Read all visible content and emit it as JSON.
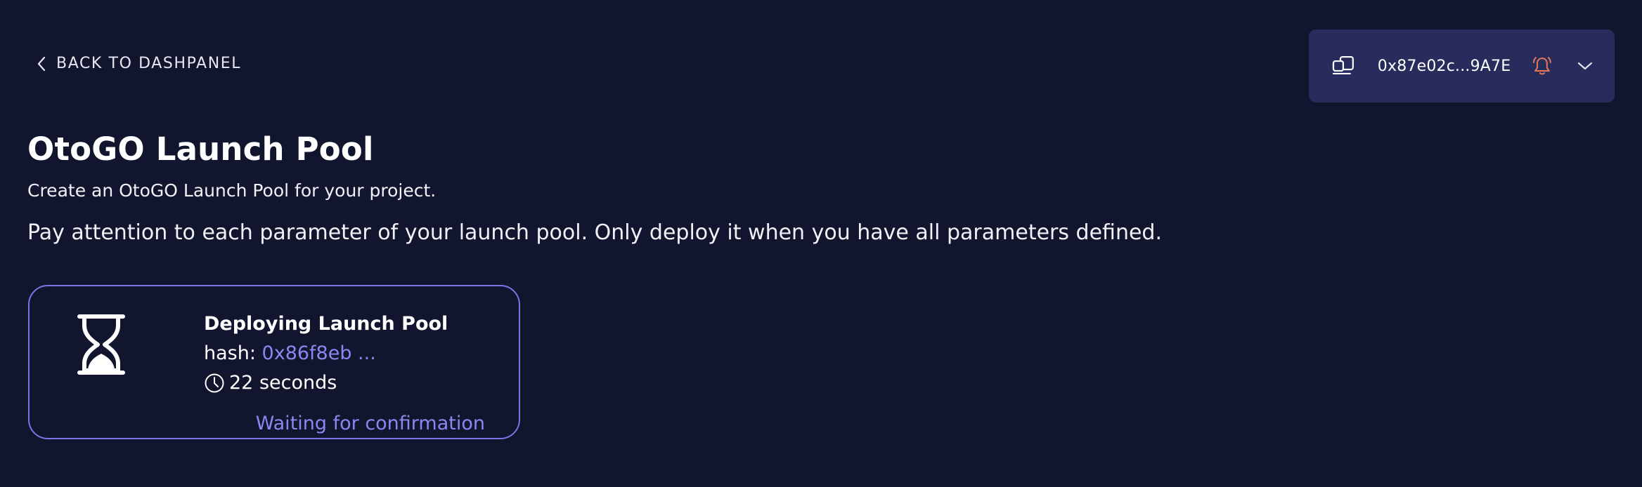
{
  "nav": {
    "back_label": "BACK TO DASHPANEL",
    "icon": "chevron-left-icon"
  },
  "wallet": {
    "address": "0x87e02c...9A7E",
    "switch_icon": "switch-network-icon",
    "bell_icon": "bell-icon",
    "bell_color": "#e8785a",
    "dropdown_icon": "chevron-down-icon",
    "background": "#272c5c"
  },
  "page": {
    "title": "OtoGO Launch Pool",
    "subtitle": "Create an OtoGO Launch Pool for your project.",
    "notice": "Pay attention to each parameter of your launch pool. Only deploy it when you have all parameters defined."
  },
  "deployment": {
    "title": "Deploying Launch Pool",
    "hash_label": "hash: ",
    "hash_value": "0x86f8eb ...",
    "elapsed": "22 seconds",
    "status": "Waiting for confirmation",
    "icon": "hourglass-icon",
    "clock_icon": "clock-icon",
    "accent_color": "#7c74e8"
  },
  "theme": {
    "background": "#11152d",
    "text": "#ffffff",
    "accent": "#8d86f2"
  }
}
